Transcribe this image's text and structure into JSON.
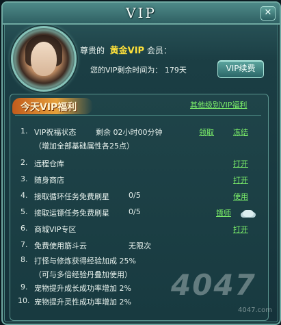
{
  "window": {
    "title": "VIP",
    "close_glyph": "✕"
  },
  "header": {
    "greeting_prefix": "尊贵的",
    "vip_level": "黄金VIP",
    "greeting_suffix": "会员：",
    "remaining_label": "您的VIP剩余时间为：",
    "remaining_value": "179天",
    "renew_button": "VIP续费"
  },
  "panel": {
    "title": "今天VIP福利",
    "other_link": "其他级别VIP福利"
  },
  "benefits": [
    {
      "num": "1.",
      "label": "VIP祝福状态",
      "value": "剩余 02小时00分钟",
      "actions": [
        "领取",
        "冻结"
      ],
      "sub": "（增加全部基础属性各25点）"
    },
    {
      "num": "2.",
      "label": "远程仓库",
      "value": "",
      "actions": [
        "打开"
      ]
    },
    {
      "num": "3.",
      "label": "随身商店",
      "value": "",
      "actions": [
        "打开"
      ]
    },
    {
      "num": "4.",
      "label": "接取循环任务免费刷星",
      "value": "0/5",
      "actions": [
        "使用"
      ]
    },
    {
      "num": "5.",
      "label": "接取运镖任务免费刷星",
      "value": "0/5",
      "actions": [
        "镖师"
      ],
      "icon": "cloud-icon"
    },
    {
      "num": "6.",
      "label": "商城VIP专区",
      "value": "",
      "actions": [
        "打开"
      ]
    },
    {
      "num": "7.",
      "label": "免费使用筋斗云",
      "value": "无限次",
      "actions": []
    },
    {
      "num": "8.",
      "label": "打怪与修炼获得经验加成 25%",
      "value": "",
      "actions": [],
      "sub": "（可与多倍经验丹叠加使用）"
    },
    {
      "num": "9.",
      "label": "宠物提升成长成功率增加 2%",
      "value": "",
      "actions": []
    },
    {
      "num": "10.",
      "label": "宠物提升灵性成功率增加 2%",
      "value": "",
      "actions": []
    }
  ],
  "watermark": {
    "main": "4047",
    "sub": "4047.com"
  },
  "colors": {
    "gold": "#ffe13a",
    "link_green": "#7cf06a",
    "panel_bg": "#183a40",
    "frame_border": "#6fa9a2"
  }
}
